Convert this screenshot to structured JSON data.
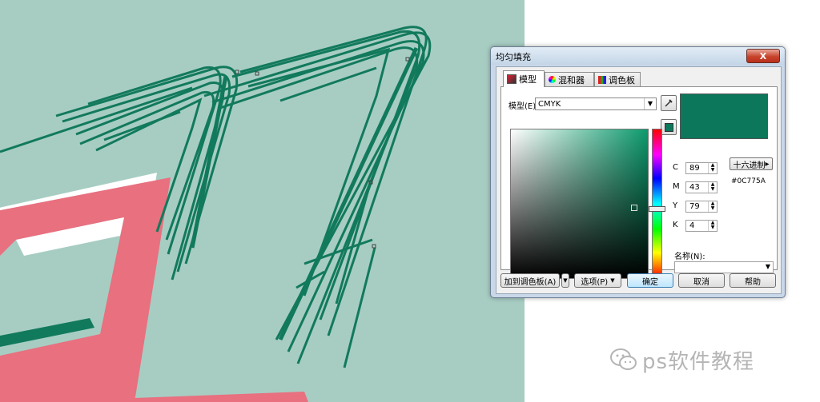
{
  "dialog": {
    "title": "均匀填充",
    "close_label": "X",
    "tabs": [
      {
        "label": "模型",
        "icon": "model-tab-icon"
      },
      {
        "label": "混和器",
        "icon": "mixer-tab-icon"
      },
      {
        "label": "调色板",
        "icon": "palette-tab-icon"
      }
    ],
    "model_label": "模型(E):",
    "model_value": "CMYK",
    "hex_mode_label": "十六进制",
    "hex_value": "#0C775A",
    "preview_color": "#0c775a",
    "channels": [
      {
        "name": "C",
        "value": "89"
      },
      {
        "name": "M",
        "value": "43"
      },
      {
        "name": "Y",
        "value": "79"
      },
      {
        "name": "K",
        "value": "4"
      }
    ],
    "name_label": "名称(N):",
    "name_value": "",
    "buttons": {
      "add_palette": "加到调色板(A)",
      "options": "选项(P)",
      "ok": "确定",
      "cancel": "取消",
      "help": "帮助"
    }
  },
  "canvas": {
    "background": "#a7cdc3",
    "stroke_color": "#127a5c",
    "shape_color": "#e8707f"
  },
  "watermark": {
    "text": "ps软件教程"
  }
}
